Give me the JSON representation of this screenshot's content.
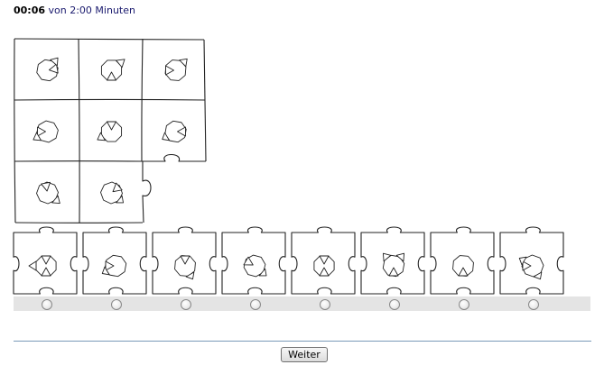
{
  "timer": {
    "elapsed": "00:06",
    "limit_text": "von 2:00 Minuten"
  },
  "puzzle": {
    "matrix": [
      [
        "cell-1-1",
        "cell-1-2",
        "cell-1-3"
      ],
      [
        "cell-2-1",
        "cell-2-2",
        "cell-2-3"
      ],
      [
        "cell-3-1",
        "cell-3-2",
        "missing"
      ]
    ],
    "option_count": 8
  },
  "next_button": {
    "label": "Weiter"
  },
  "colors": {
    "timer_text": "#1a1a6e",
    "radio_bar": "#e4e4e4",
    "divider": "#7a9ab8"
  }
}
